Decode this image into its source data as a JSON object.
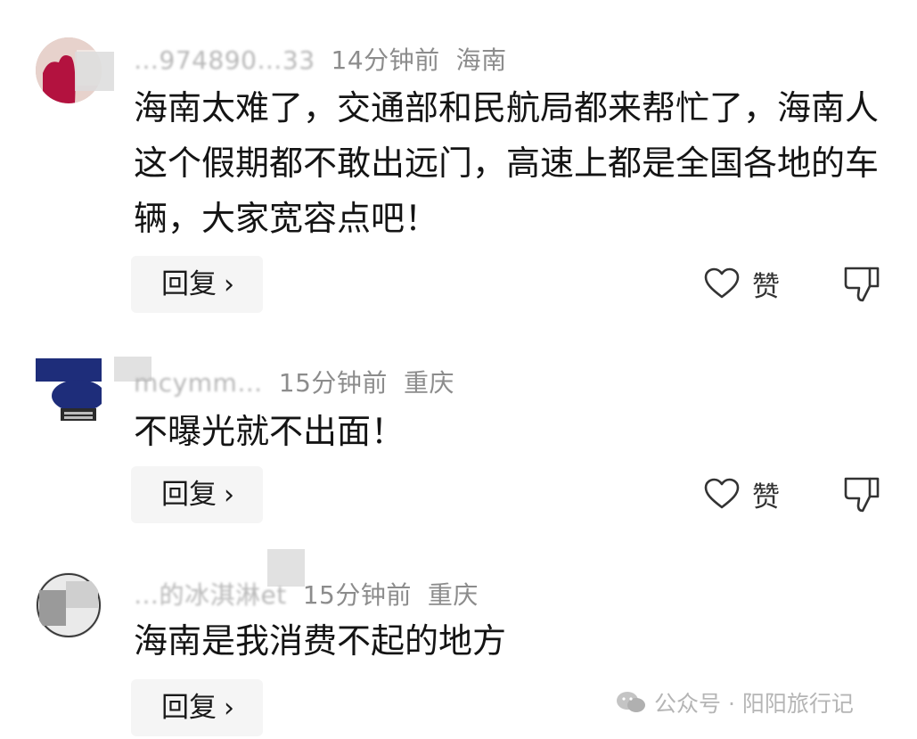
{
  "comments": [
    {
      "username": "…974890…33",
      "time": "14分钟前",
      "location": "海南",
      "text": "海南太难了，交通部和民航局都来帮忙了，海南人这个假期都不敢出远门，高速上都是全国各地的车辆，大家宽容点吧！",
      "reply_label": "回复",
      "like_label": "赞"
    },
    {
      "username": "mcymm…",
      "time": "15分钟前",
      "location": "重庆",
      "text": "不曝光就不出面！",
      "reply_label": "回复",
      "like_label": "赞"
    },
    {
      "username": "…的冰淇淋et",
      "time": "15分钟前",
      "location": "重庆",
      "text": "海南是我消费不起的地方",
      "reply_label": "回复"
    }
  ],
  "icons": {
    "reply_chevron": "chevron-right-icon",
    "like": "heart-icon",
    "dislike": "thumbs-down-icon",
    "watermark": "wechat-icon"
  },
  "watermark": {
    "text": "公众号 · 阳阳旅行记"
  },
  "colors": {
    "text": "#141414",
    "meta": "#8c8c8c",
    "reply_bg": "#f5f5f5",
    "avatar1": "#b3123f",
    "avatar2": "#1e2d7a"
  }
}
